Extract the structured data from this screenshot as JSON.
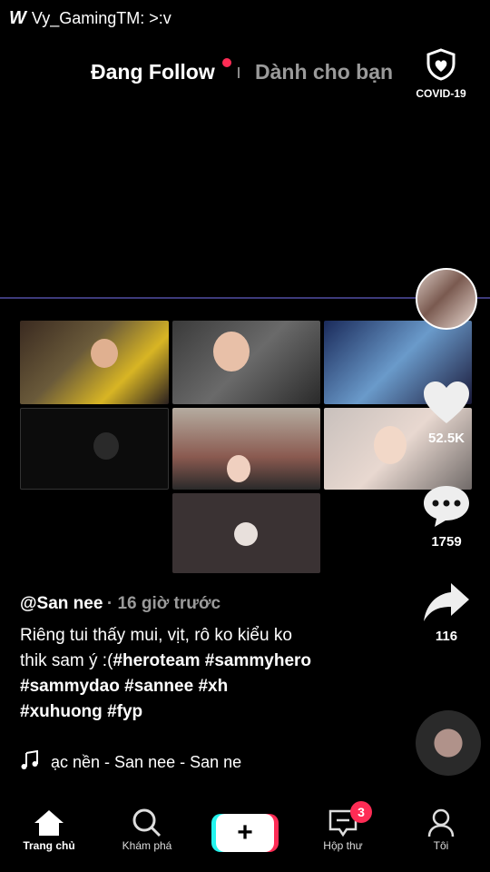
{
  "status": {
    "app_icon": "W",
    "text": "Vy_GamingTM: >:v"
  },
  "top_tabs": {
    "following": "Đang Follow",
    "for_you": "Dành cho bạn",
    "covid_label": "COVID-19"
  },
  "actions": {
    "likes": "52.5K",
    "comments": "1759",
    "shares": "116"
  },
  "caption": {
    "author": "@San nee",
    "time": "· 16 giờ trước",
    "text_line1": "Riêng tui thấy mui, vịt, rô ko kiểu ko",
    "text_line2_plain": "thik sam ý :(",
    "hashtags": [
      "#heroteam",
      "#sammyhero",
      "#sammydao",
      "#sannee",
      "#xh",
      "#xuhuong",
      "#fyp"
    ]
  },
  "music": {
    "track": "ạc nền - San nee - San ne"
  },
  "nav": {
    "home": "Trang chủ",
    "explore": "Khám phá",
    "inbox": "Hộp thư",
    "inbox_badge": "3",
    "me": "Tôi",
    "create": "+"
  },
  "colors": {
    "accent_red": "#fe2c55",
    "accent_cyan": "#25f4ee",
    "video_border": "#3d3a7a"
  }
}
